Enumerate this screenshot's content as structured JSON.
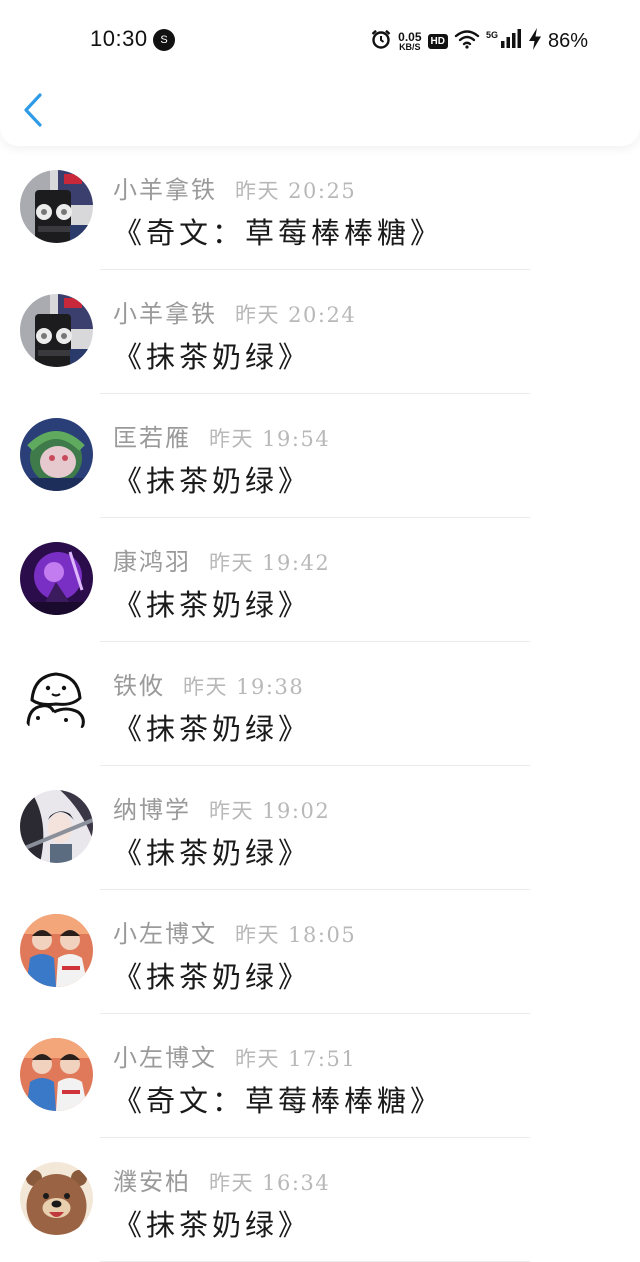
{
  "status_bar": {
    "time": "10:30",
    "notification_badge": "S",
    "net_speed_value": "0.05",
    "net_speed_unit": "KB/S",
    "hd_label": "HD",
    "network_label": "5G",
    "battery": "86%",
    "icons": [
      "alarm-icon",
      "wifi-icon",
      "signal-icon",
      "charging-icon"
    ]
  },
  "header": {
    "back_icon": "chevron-left-icon",
    "accent_color": "#2e9be6"
  },
  "comments": [
    {
      "name": "小羊拿铁",
      "time": "昨天 20:25",
      "message": "《奇文：草莓棒棒糖》",
      "avatar": "avatar-robot-toy"
    },
    {
      "name": "小羊拿铁",
      "time": "昨天 20:24",
      "message": "《抹茶奶绿》",
      "avatar": "avatar-robot-toy"
    },
    {
      "name": "匡若雁",
      "time": "昨天 19:54",
      "message": "《抹茶奶绿》",
      "avatar": "avatar-dragon"
    },
    {
      "name": "康鸿羽",
      "time": "昨天 19:42",
      "message": "《抹茶奶绿》",
      "avatar": "avatar-purple-warrior"
    },
    {
      "name": "铁攸",
      "time": "昨天 19:38",
      "message": "《抹茶奶绿》",
      "avatar": "avatar-doodle-faces"
    },
    {
      "name": "纳博学",
      "time": "昨天 19:02",
      "message": "《抹茶奶绿》",
      "avatar": "avatar-anime-girl"
    },
    {
      "name": "小左博文",
      "time": "昨天 18:05",
      "message": "《抹茶奶绿》",
      "avatar": "avatar-two-boys"
    },
    {
      "name": "小左博文",
      "time": "昨天 17:51",
      "message": "《奇文：草莓棒棒糖》",
      "avatar": "avatar-two-boys"
    },
    {
      "name": "濮安柏",
      "time": "昨天 16:34",
      "message": "《抹茶奶绿》",
      "avatar": "avatar-brown-bear"
    }
  ]
}
